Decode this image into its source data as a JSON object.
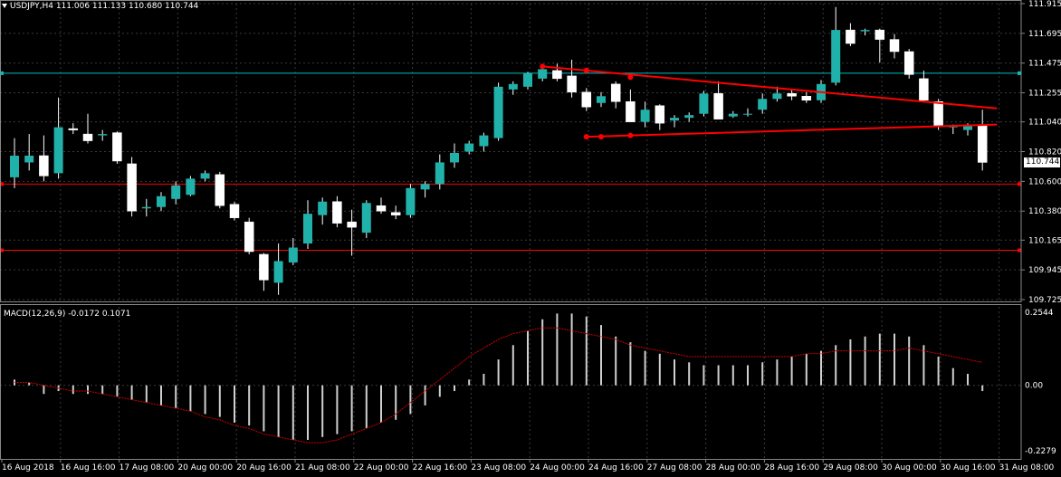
{
  "window": {
    "symbol_line": "USDJPY,H4  111.006 111.133 110.680 110.744",
    "macd_line": "MACD(12,26,9) -0.0172 0.1071"
  },
  "price_axis": {
    "ticks": [
      "111.915",
      "111.695",
      "111.475",
      "111.255",
      "111.040",
      "110.820",
      "110.600",
      "110.380",
      "110.165",
      "109.945",
      "109.725"
    ],
    "current_price": "110.744"
  },
  "macd_axis": {
    "ticks": [
      "0.2544",
      "0.00",
      "-0.2279"
    ]
  },
  "time_axis": {
    "labels": [
      "16 Aug 2018",
      "16 Aug 16:00",
      "17 Aug 08:00",
      "20 Aug 00:00",
      "20 Aug 16:00",
      "21 Aug 08:00",
      "22 Aug 00:00",
      "22 Aug 16:00",
      "23 Aug 08:00",
      "24 Aug 00:00",
      "24 Aug 16:00",
      "27 Aug 08:00",
      "28 Aug 00:00",
      "28 Aug 16:00",
      "29 Aug 08:00",
      "30 Aug 00:00",
      "30 Aug 16:00",
      "31 Aug 08:00"
    ]
  },
  "colors": {
    "background": "#000000",
    "grid": "#3a3a3a",
    "bull_candle": "#20b2aa",
    "bear_candle": "#ffffff",
    "trendline": "#ff0000",
    "horizontal_cyan": "#00bfbf",
    "macd_hist": "#d0d0d0",
    "signal": "#cc0000"
  },
  "chart_data": {
    "type": "candlestick",
    "candles": [
      {
        "o": 110.63,
        "h": 110.92,
        "l": 110.55,
        "c": 110.79
      },
      {
        "o": 110.74,
        "h": 110.95,
        "l": 110.68,
        "c": 110.79
      },
      {
        "o": 110.79,
        "h": 110.94,
        "l": 110.6,
        "c": 110.64
      },
      {
        "o": 110.66,
        "h": 111.22,
        "l": 110.62,
        "c": 111.0
      },
      {
        "o": 110.99,
        "h": 111.03,
        "l": 110.95,
        "c": 110.98
      },
      {
        "o": 110.95,
        "h": 111.1,
        "l": 110.88,
        "c": 110.9
      },
      {
        "o": 110.94,
        "h": 110.98,
        "l": 110.9,
        "c": 110.95
      },
      {
        "o": 110.96,
        "h": 110.97,
        "l": 110.73,
        "c": 110.75
      },
      {
        "o": 110.73,
        "h": 110.78,
        "l": 110.34,
        "c": 110.38
      },
      {
        "o": 110.4,
        "h": 110.47,
        "l": 110.34,
        "c": 110.41
      },
      {
        "o": 110.41,
        "h": 110.52,
        "l": 110.38,
        "c": 110.49
      },
      {
        "o": 110.47,
        "h": 110.6,
        "l": 110.43,
        "c": 110.57
      },
      {
        "o": 110.5,
        "h": 110.64,
        "l": 110.49,
        "c": 110.62
      },
      {
        "o": 110.62,
        "h": 110.68,
        "l": 110.6,
        "c": 110.66
      },
      {
        "o": 110.65,
        "h": 110.67,
        "l": 110.4,
        "c": 110.42
      },
      {
        "o": 110.43,
        "h": 110.45,
        "l": 110.31,
        "c": 110.33
      },
      {
        "o": 110.3,
        "h": 110.33,
        "l": 110.06,
        "c": 110.08
      },
      {
        "o": 110.06,
        "h": 110.07,
        "l": 109.79,
        "c": 109.87
      },
      {
        "o": 109.85,
        "h": 110.14,
        "l": 109.76,
        "c": 110.01
      },
      {
        "o": 110.0,
        "h": 110.18,
        "l": 109.98,
        "c": 110.11
      },
      {
        "o": 110.14,
        "h": 110.46,
        "l": 110.1,
        "c": 110.36
      },
      {
        "o": 110.35,
        "h": 110.48,
        "l": 110.28,
        "c": 110.45
      },
      {
        "o": 110.45,
        "h": 110.49,
        "l": 110.26,
        "c": 110.29
      },
      {
        "o": 110.3,
        "h": 110.39,
        "l": 110.05,
        "c": 110.26
      },
      {
        "o": 110.22,
        "h": 110.46,
        "l": 110.18,
        "c": 110.44
      },
      {
        "o": 110.42,
        "h": 110.48,
        "l": 110.36,
        "c": 110.38
      },
      {
        "o": 110.37,
        "h": 110.42,
        "l": 110.32,
        "c": 110.35
      },
      {
        "o": 110.35,
        "h": 110.58,
        "l": 110.33,
        "c": 110.55
      },
      {
        "o": 110.54,
        "h": 110.6,
        "l": 110.48,
        "c": 110.58
      },
      {
        "o": 110.58,
        "h": 110.8,
        "l": 110.54,
        "c": 110.74
      },
      {
        "o": 110.74,
        "h": 110.88,
        "l": 110.7,
        "c": 110.81
      },
      {
        "o": 110.82,
        "h": 110.9,
        "l": 110.8,
        "c": 110.88
      },
      {
        "o": 110.86,
        "h": 110.96,
        "l": 110.82,
        "c": 110.94
      },
      {
        "o": 110.92,
        "h": 111.33,
        "l": 110.9,
        "c": 111.3
      },
      {
        "o": 111.28,
        "h": 111.34,
        "l": 111.24,
        "c": 111.32
      },
      {
        "o": 111.3,
        "h": 111.41,
        "l": 111.28,
        "c": 111.4
      },
      {
        "o": 111.36,
        "h": 111.47,
        "l": 111.34,
        "c": 111.43
      },
      {
        "o": 111.42,
        "h": 111.47,
        "l": 111.34,
        "c": 111.36
      },
      {
        "o": 111.38,
        "h": 111.5,
        "l": 111.22,
        "c": 111.26
      },
      {
        "o": 111.26,
        "h": 111.29,
        "l": 111.12,
        "c": 111.15
      },
      {
        "o": 111.18,
        "h": 111.26,
        "l": 111.15,
        "c": 111.23
      },
      {
        "o": 111.32,
        "h": 111.34,
        "l": 111.14,
        "c": 111.19
      },
      {
        "o": 111.19,
        "h": 111.28,
        "l": 111.06,
        "c": 111.04
      },
      {
        "o": 111.04,
        "h": 111.19,
        "l": 111.0,
        "c": 111.13
      },
      {
        "o": 111.16,
        "h": 111.17,
        "l": 110.98,
        "c": 111.03
      },
      {
        "o": 111.05,
        "h": 111.09,
        "l": 111.0,
        "c": 111.07
      },
      {
        "o": 111.07,
        "h": 111.11,
        "l": 111.04,
        "c": 111.09
      },
      {
        "o": 111.1,
        "h": 111.27,
        "l": 111.08,
        "c": 111.25
      },
      {
        "o": 111.25,
        "h": 111.34,
        "l": 111.14,
        "c": 111.06
      },
      {
        "o": 111.08,
        "h": 111.12,
        "l": 111.07,
        "c": 111.1
      },
      {
        "o": 111.1,
        "h": 111.14,
        "l": 111.08,
        "c": 111.1
      },
      {
        "o": 111.13,
        "h": 111.25,
        "l": 111.1,
        "c": 111.21
      },
      {
        "o": 111.21,
        "h": 111.3,
        "l": 111.19,
        "c": 111.25
      },
      {
        "o": 111.25,
        "h": 111.28,
        "l": 111.2,
        "c": 111.23
      },
      {
        "o": 111.23,
        "h": 111.26,
        "l": 111.18,
        "c": 111.2
      },
      {
        "o": 111.2,
        "h": 111.35,
        "l": 111.18,
        "c": 111.32
      },
      {
        "o": 111.33,
        "h": 111.89,
        "l": 111.31,
        "c": 111.72
      },
      {
        "o": 111.72,
        "h": 111.77,
        "l": 111.6,
        "c": 111.62
      },
      {
        "o": 111.71,
        "h": 111.73,
        "l": 111.68,
        "c": 111.72
      },
      {
        "o": 111.72,
        "h": 111.73,
        "l": 111.48,
        "c": 111.65
      },
      {
        "o": 111.65,
        "h": 111.69,
        "l": 111.51,
        "c": 111.56
      },
      {
        "o": 111.56,
        "h": 111.58,
        "l": 111.36,
        "c": 111.39
      },
      {
        "o": 111.36,
        "h": 111.42,
        "l": 111.19,
        "c": 111.2
      },
      {
        "o": 111.19,
        "h": 111.21,
        "l": 110.98,
        "c": 111.01
      },
      {
        "o": 111.0,
        "h": 111.02,
        "l": 110.95,
        "c": 111.01
      },
      {
        "o": 110.98,
        "h": 111.03,
        "l": 110.94,
        "c": 111.02
      },
      {
        "o": 111.01,
        "h": 111.13,
        "l": 110.68,
        "c": 110.74
      }
    ],
    "macd": [
      0.02,
      0.01,
      -0.03,
      -0.02,
      -0.03,
      -0.03,
      -0.03,
      -0.04,
      -0.05,
      -0.06,
      -0.07,
      -0.08,
      -0.09,
      -0.1,
      -0.11,
      -0.13,
      -0.14,
      -0.16,
      -0.18,
      -0.19,
      -0.19,
      -0.18,
      -0.17,
      -0.16,
      -0.15,
      -0.13,
      -0.12,
      -0.1,
      -0.07,
      -0.04,
      -0.02,
      0.02,
      0.04,
      0.09,
      0.14,
      0.19,
      0.23,
      0.25,
      0.25,
      0.24,
      0.21,
      0.17,
      0.15,
      0.12,
      0.11,
      0.09,
      0.08,
      0.07,
      0.07,
      0.07,
      0.07,
      0.08,
      0.09,
      0.1,
      0.11,
      0.12,
      0.14,
      0.16,
      0.17,
      0.18,
      0.18,
      0.17,
      0.14,
      0.1,
      0.06,
      0.04,
      -0.02
    ],
    "signal": [
      0.01,
      0.01,
      0.0,
      -0.01,
      -0.02,
      -0.02,
      -0.03,
      -0.04,
      -0.05,
      -0.06,
      -0.07,
      -0.08,
      -0.09,
      -0.11,
      -0.12,
      -0.14,
      -0.15,
      -0.17,
      -0.18,
      -0.19,
      -0.2,
      -0.2,
      -0.19,
      -0.17,
      -0.15,
      -0.13,
      -0.1,
      -0.06,
      -0.02,
      0.02,
      0.06,
      0.1,
      0.13,
      0.16,
      0.18,
      0.19,
      0.2,
      0.2,
      0.19,
      0.18,
      0.17,
      0.16,
      0.14,
      0.13,
      0.12,
      0.11,
      0.1,
      0.1,
      0.1,
      0.1,
      0.1,
      0.1,
      0.1,
      0.1,
      0.11,
      0.11,
      0.12,
      0.12,
      0.12,
      0.12,
      0.12,
      0.13,
      0.12,
      0.11,
      0.1,
      0.09,
      0.08
    ],
    "ylim": [
      109.725,
      111.915
    ],
    "macd_ylim": [
      -0.2279,
      0.2544
    ],
    "horizontal_lines": [
      {
        "price": 111.4,
        "color": "cyan"
      },
      {
        "price": 110.58,
        "color": "red"
      },
      {
        "price": 110.09,
        "color": "red"
      }
    ],
    "trendlines": [
      {
        "from": {
          "bar": 36,
          "price": 111.45
        },
        "to": {
          "bar": 66,
          "price": 111.14
        },
        "points": [
          {
            "bar": 36,
            "price": 111.45
          },
          {
            "bar": 39,
            "price": 111.42
          },
          {
            "bar": 42,
            "price": 111.37
          }
        ]
      },
      {
        "from": {
          "bar": 39,
          "price": 110.93
        },
        "to": {
          "bar": 66,
          "price": 111.02
        },
        "points": [
          {
            "bar": 39,
            "price": 110.93
          },
          {
            "bar": 40,
            "price": 110.93
          },
          {
            "bar": 42,
            "price": 110.94
          }
        ]
      }
    ]
  }
}
